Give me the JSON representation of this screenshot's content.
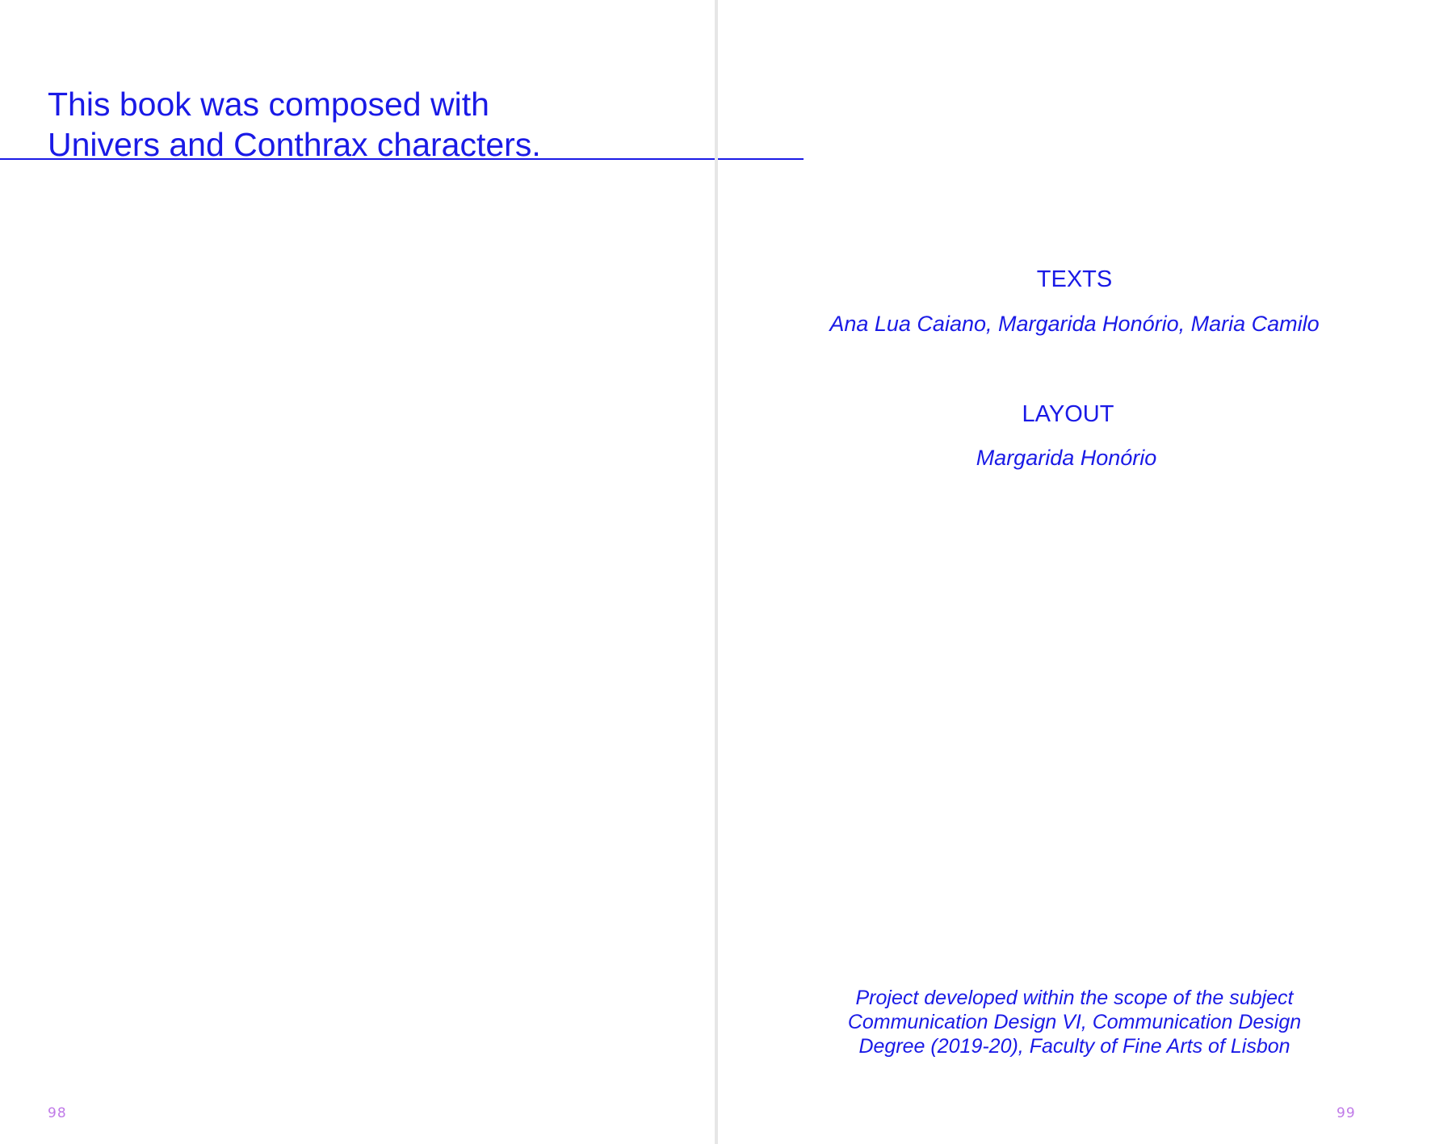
{
  "left_page": {
    "colophon_lines": [
      "This book was composed with",
      "Univers and Conthrax characters."
    ],
    "page_number": "98"
  },
  "right_page": {
    "credits": [
      {
        "label": "TEXTS",
        "names": "Ana Lua Caiano, Margarida Honório, Maria Camilo"
      },
      {
        "label": "LAYOUT",
        "names": "Margarida Honório"
      }
    ],
    "project_lines": [
      "Project developed within the scope of the subject",
      "Communication Design VI, Communication Design",
      "Degree (2019-20), Faculty of Fine Arts of Lisbon"
    ],
    "page_number": "99"
  },
  "colors": {
    "text": "#1a1ae6",
    "folio": "#c07ae8",
    "gutter": "#e6e6e6",
    "background": "#ffffff"
  }
}
